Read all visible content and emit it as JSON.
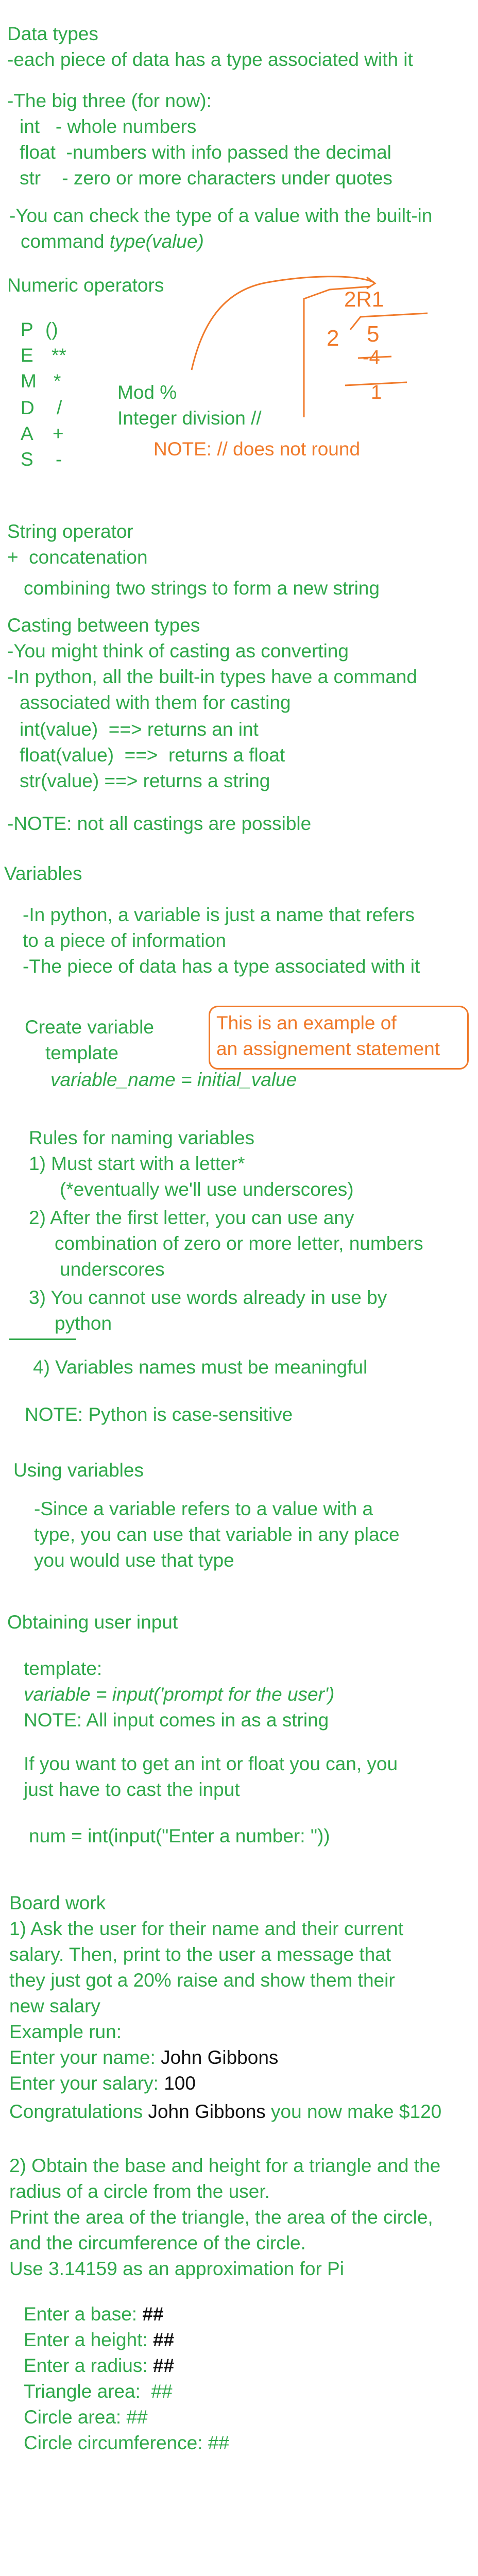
{
  "colors": {
    "green": "#2fa84a",
    "orange": "#f07a2a",
    "black": "#111111",
    "background": "#ffffff"
  },
  "data_types": {
    "heading": "Data types",
    "intro": "-each piece of data has a type associated with it",
    "big_three": "-The big three (for now):",
    "int_line": "int   - whole numbers",
    "float_line": "float  -numbers with info passed the decimal",
    "str_line": "str    - zero or more characters under quotes",
    "check_line1": "-You can check the type of a value with the built-in",
    "check_line2_prefix": "command ",
    "check_line2_code": "type(value)"
  },
  "numeric": {
    "heading": "Numeric operators",
    "pemdas": [
      {
        "letter": "P",
        "symbol": "()"
      },
      {
        "letter": "E",
        "symbol": "**"
      },
      {
        "letter": "M",
        "symbol": "*"
      },
      {
        "letter": "D",
        "symbol": "/"
      },
      {
        "letter": "A",
        "symbol": "+"
      },
      {
        "letter": "S",
        "symbol": "-"
      }
    ],
    "mod": "Mod %",
    "int_div": "Integer division //",
    "note": "NOTE: // does not round",
    "long_div": {
      "quotient": "2R1",
      "divisor": "2",
      "dividend": "5",
      "subtract": "-4",
      "remainder": "1"
    }
  },
  "string_op": {
    "heading": "String operator",
    "concat": "+  concatenation",
    "desc": "combining two strings to form a new string"
  },
  "casting": {
    "heading": "Casting between types",
    "l1": "-You might think of casting as converting",
    "l2": "-In python, all the built-in types have a command",
    "l3": "associated with them for casting",
    "int": "int(value)  ==> returns an int",
    "float": "float(value)  ==>  returns a float",
    "str": "str(value) ==> returns a string",
    "note": "-NOTE: not all castings are possible"
  },
  "variables": {
    "heading": "Variables",
    "l1": "-In python, a variable is just a name that refers",
    "l2": "to a piece of information",
    "l3": "-The piece of data has a type associated with it",
    "create": "Create variable",
    "template": "template",
    "template_code": "variable_name = initial_value",
    "box1": "This is an example of",
    "box2": "an assignement statement",
    "rules_heading": "Rules for naming variables",
    "r1": "1) Must start with a letter*",
    "r1b": "(*eventually we'll use underscores)",
    "r2": "2) After the first letter, you can use any",
    "r2b": "combination of zero or more letter, numbers",
    "r2c": "underscores",
    "r3": "3) You cannot use words already in use by",
    "r3b": "python",
    "r4": "4) Variables names must be meaningful",
    "case_note": "NOTE: Python is case-sensitive"
  },
  "using": {
    "heading": "Using variables",
    "l1": "-Since a variable refers to a value with a",
    "l2": "type, you can use that variable in any place",
    "l3": "you would use that type"
  },
  "input": {
    "heading": "Obtaining user input",
    "template": "template:",
    "code": "variable = input('prompt for the user')",
    "note": "NOTE: All input comes in as a string",
    "cast1": "If you want to get an int or float you can, you",
    "cast2": "just have to cast the input",
    "example": "num = int(input(\"Enter a number: \"))"
  },
  "board": {
    "heading": "Board work",
    "q1_l1": "1) Ask the user for their name and their current",
    "q1_l2": "salary. Then, print to the user a message that",
    "q1_l3": "they just got a 20% raise and show them their",
    "q1_l4": "new salary",
    "example_run": "Example run:",
    "name_prompt": "Enter your name: ",
    "name_value": "John Gibbons",
    "salary_prompt": "Enter your salary: ",
    "salary_value": "100",
    "congrats_prefix": "Congratulations ",
    "congrats_name": "John Gibbons",
    "congrats_suffix": " you now make $120",
    "q2_l1": "2) Obtain the base and height for a triangle and the",
    "q2_l2": "radius of a circle from the user.",
    "q2_l3": "Print the area of the triangle, the area of the circle,",
    "q2_l4": "and the circumference of the circle.",
    "q2_l5": "Use 3.14159 as an approximation for Pi",
    "placeholder": "##",
    "base": "Enter a base: ",
    "height": "Enter a height: ",
    "radius": "Enter a radius: ",
    "tri_area": "Triangle area:  ",
    "circ_area": "Circle area: ",
    "circ_circ": "Circle circumference: "
  }
}
